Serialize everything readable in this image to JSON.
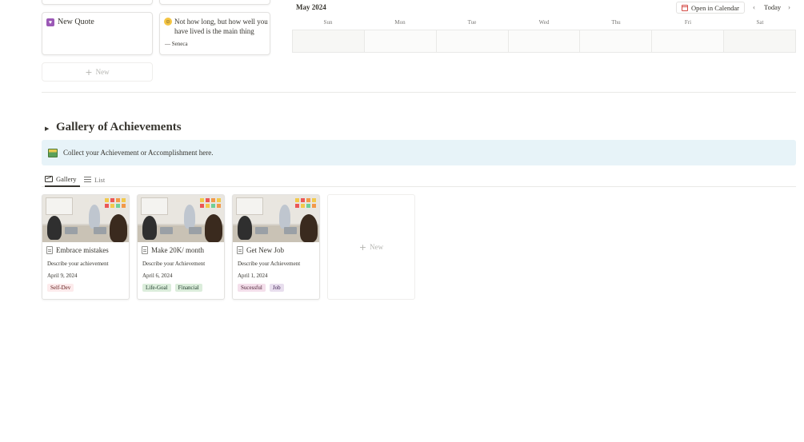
{
  "quotes": {
    "new_quote_label": "New Quote",
    "quote_text": "Not how long, but how well you have lived is the main thing",
    "quote_author": "— Seneca",
    "new_label": "New"
  },
  "calendar": {
    "month": "May 2024",
    "open_label": "Open in Calendar",
    "today_label": "Today",
    "prev_icon": "‹",
    "next_icon": "›",
    "weekdays": [
      "Sun",
      "Mon",
      "Tue",
      "Wed",
      "Thu",
      "Fri",
      "Sat"
    ]
  },
  "section": {
    "toggle_icon": "▶",
    "title": "Gallery of Achievements"
  },
  "callout": {
    "text": "Collect your Achievement or Accomplishment here."
  },
  "tabs": {
    "gallery": "Gallery",
    "list": "List"
  },
  "gallery": {
    "cards": [
      {
        "title": "Embrace mistakes",
        "description": "Describe your achievement",
        "date": "April 9, 2024",
        "tags": [
          {
            "label": "Self-Dev",
            "bg": "#fdebec",
            "fg": "#5d1715"
          }
        ]
      },
      {
        "title": "Make 20K/ month",
        "description": "Describe your Achievement",
        "date": "April 6, 2024",
        "tags": [
          {
            "label": "Life-Goal",
            "bg": "#dbeddb",
            "fg": "#1c3829"
          },
          {
            "label": "Financial",
            "bg": "#dbeddb",
            "fg": "#1c3829"
          }
        ]
      },
      {
        "title": "Get New Job",
        "description": "Describe your Achievement",
        "date": "April 1, 2024",
        "tags": [
          {
            "label": "Sucessful",
            "bg": "#f4dfeb",
            "fg": "#4c2337"
          },
          {
            "label": "Job",
            "bg": "#e8deee",
            "fg": "#412454"
          }
        ]
      }
    ],
    "new_label": "New"
  },
  "colors": {
    "callout_bg": "#e7f3f8",
    "text": "#37352f",
    "muted": "#787774"
  }
}
